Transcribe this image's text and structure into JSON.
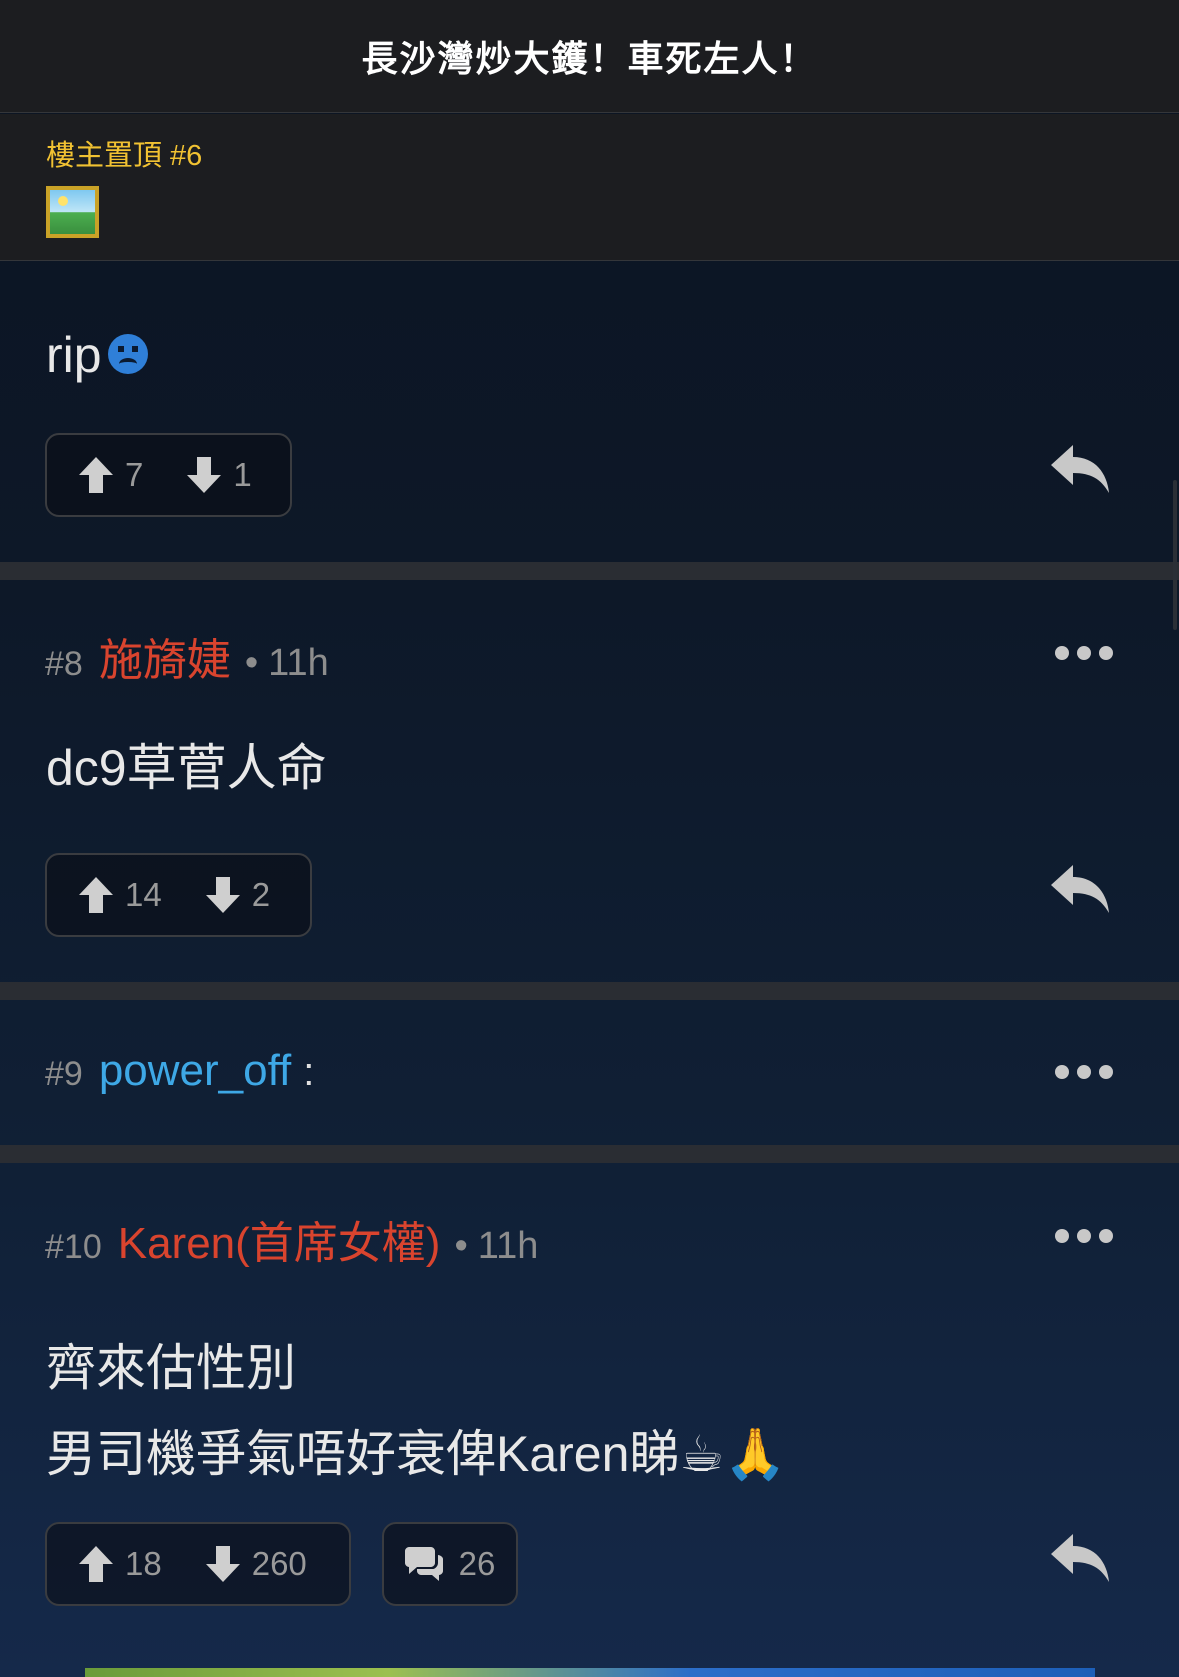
{
  "header": {
    "title": "長沙灣炒大鑊！車死左人！"
  },
  "pinned": {
    "label": "樓主置頂 #6"
  },
  "posts": [
    {
      "body": "rip",
      "emoji": "sad-face",
      "upvotes": "7",
      "downvotes": "1"
    },
    {
      "number": "#8",
      "user": "施旖婕",
      "separator": "•",
      "time": "11h",
      "body": "dc9草菅人命",
      "upvotes": "14",
      "downvotes": "2"
    },
    {
      "number": "#9",
      "user": "power_off",
      "colon": ":"
    },
    {
      "number": "#10",
      "user": "Karen(首席女權)",
      "separator": "•",
      "time": "11h",
      "body_line1": "齊來估性別",
      "body_line2": "男司機爭氣唔好衰俾Karen睇☕🙏",
      "upvotes": "18",
      "downvotes": "260",
      "comments": "26"
    }
  ],
  "colors": {
    "username_red": "#d9442e",
    "username_blue": "#3ea8e6",
    "pinned_gold": "#f1c232"
  }
}
